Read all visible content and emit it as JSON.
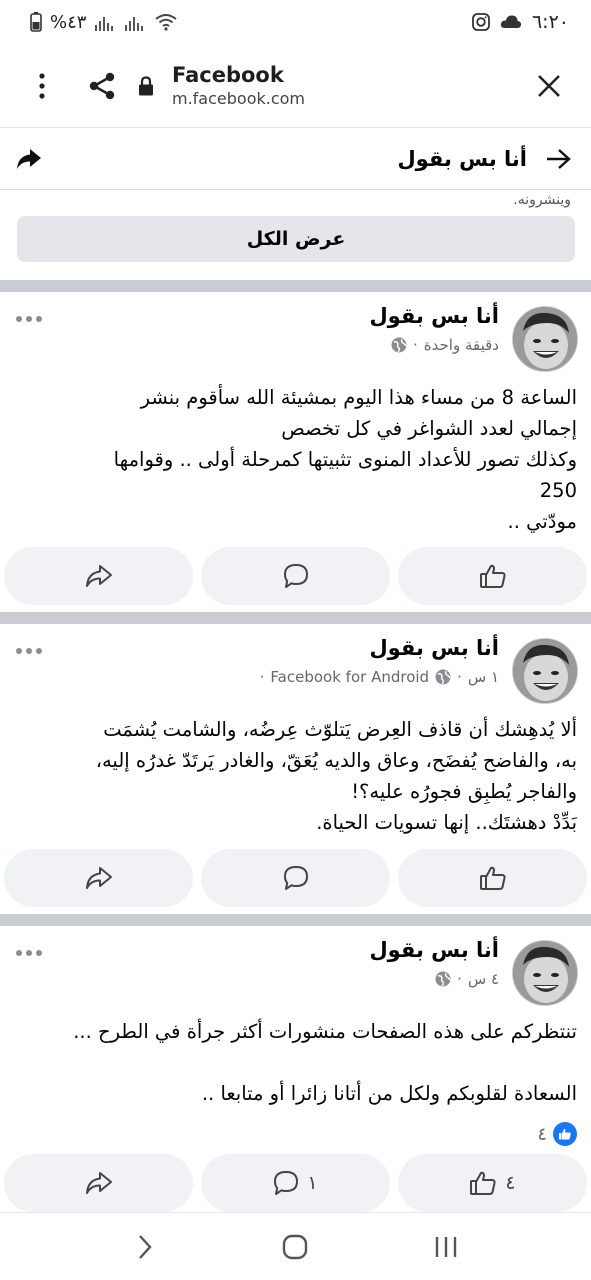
{
  "status_bar": {
    "time": "٦:٢٠",
    "battery": "%٤٣",
    "icons": [
      "instagram-icon",
      "cloud-icon",
      "wifi-icon",
      "signal-icon",
      "battery-icon"
    ]
  },
  "browser": {
    "title": "Facebook",
    "url": "m.facebook.com",
    "icons": [
      "more-vert-icon",
      "share-icon",
      "lock-icon",
      "close-icon"
    ]
  },
  "page_header": {
    "name": "أنا بس بقول",
    "truncated_text": "وينشرونه.",
    "see_all": "عرض الكل"
  },
  "posts": [
    {
      "author": "أنا بس بقول",
      "time": "دقيقة واحدة",
      "app": "",
      "text": [
        "الساعة 8 من مساء هذا اليوم بمشيئة الله سأقوم بنشر",
        "إجمالي لعدد الشواغر في كل تخصص",
        "وكذلك تصور للأعداد المنوى تثبيتها كمرحلة أولى ..   وقوامها",
        "250",
        "مودّتي .."
      ],
      "like_count": "",
      "comment_count": "",
      "reaction_count": ""
    },
    {
      "author": "أنا بس بقول",
      "time": "١ س",
      "app": "Facebook for Android",
      "text": [
        "ألا يُدهِشك أن قاذف العِرض يَتلوّث عِرضُه، والشامت يُشمَت",
        "به، والفاضح يُفضَح، وعاق والديه يُعَقّ، والغادر يَرتَدّ غدرُه إليه،",
        "والفاجر يُطبِق فجورُه عليه؟!",
        "بَدِّدْ دهشتَك.. إنها تسويات الحياة."
      ],
      "like_count": "",
      "comment_count": "",
      "reaction_count": ""
    },
    {
      "author": "أنا بس بقول",
      "time": "٤ س",
      "app": "",
      "text": [
        "تنتظركم على هذه الصفحات منشورات أكثر جرأة في الطرح ...",
        "",
        "السعادة لقلوبكم ولكل من أتانا زائرا أو متابعا .."
      ],
      "like_count": "٤",
      "comment_count": "١",
      "reaction_count": "٤"
    }
  ],
  "nav_bar": {
    "icons": [
      "back-icon",
      "home-icon",
      "recents-icon"
    ]
  },
  "colors": {
    "facebook_blue": "#1877f2",
    "separator": "#c9ccd1",
    "action_bg": "#f0f2f5",
    "meta_gray": "#65676b"
  }
}
